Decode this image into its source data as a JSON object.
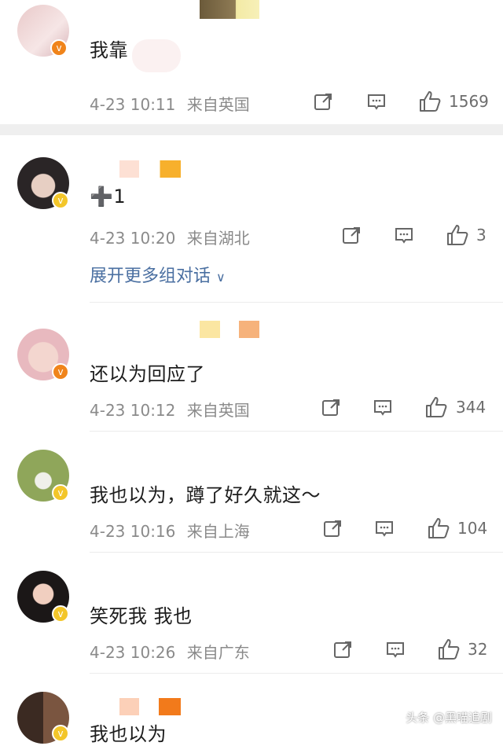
{
  "comments": [
    {
      "text": "我靠",
      "time": "4-23 10:11",
      "location": "来自英国",
      "likes": "1569",
      "badge": "orange"
    },
    {
      "text": "➕1",
      "time": "4-23 10:20",
      "location": "来自湖北",
      "likes": "3",
      "badge": "yellow",
      "expand_label": "展开更多组对话"
    },
    {
      "text": "还以为回应了",
      "time": "4-23 10:12",
      "location": "来自英国",
      "likes": "344",
      "badge": "orange"
    },
    {
      "text": "我也以为，蹲了好久就这～",
      "time": "4-23 10:16",
      "location": "来自上海",
      "likes": "104",
      "badge": "yellow"
    },
    {
      "text": "笑死我 我也",
      "time": "4-23 10:26",
      "location": "来自广东",
      "likes": "32",
      "badge": "yellow"
    },
    {
      "text": "我也以为",
      "badge": "yellow"
    }
  ],
  "watermark": "头条 @黑喵追剧",
  "colors": {
    "badge_orange": "#f0841b",
    "badge_yellow": "#f3c62a",
    "link_blue": "#4a6fa1",
    "meta_gray": "#8a8a8a"
  },
  "icons": [
    "share-icon",
    "comment-icon",
    "like-icon",
    "chevron-down-icon",
    "verified-badge-icon"
  ]
}
